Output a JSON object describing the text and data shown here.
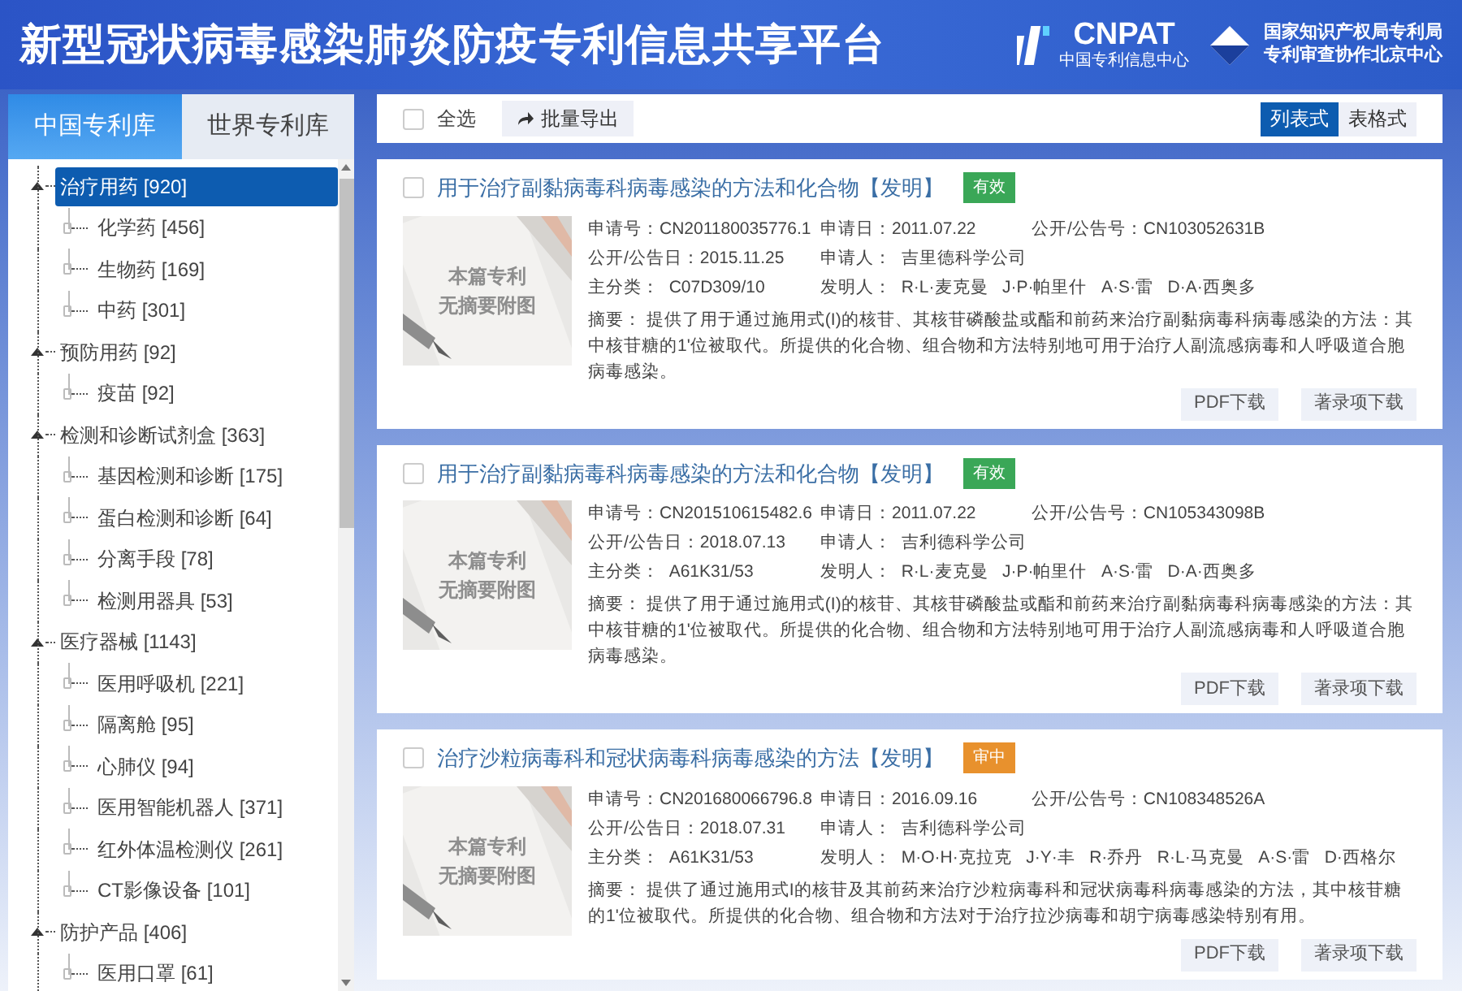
{
  "header": {
    "title": "新型冠状病毒感染肺炎防疫专利信息共享平台",
    "logo_1": {
      "name": "CNPAT",
      "subtitle": "中国专利信息中心"
    },
    "logo_2": {
      "line_1": "国家知识产权局专利局",
      "line_2": "专利审查协作北京中心"
    }
  },
  "sidebar": {
    "tabs": [
      {
        "label": "中国专利库",
        "selected": true
      },
      {
        "label": "世界专利库",
        "selected": false
      }
    ],
    "tree": [
      {
        "label": "治疗用药 [920]",
        "selected": true,
        "expanded": true,
        "children": [
          {
            "label": "化学药 [456]",
            "selected": false
          },
          {
            "label": "生物药 [169]",
            "selected": false
          },
          {
            "label": "中药 [301]",
            "selected": false
          }
        ]
      },
      {
        "label": "预防用药 [92]",
        "selected": false,
        "expanded": true,
        "children": [
          {
            "label": "疫苗 [92]",
            "selected": false
          }
        ]
      },
      {
        "label": "检测和诊断试剂盒 [363]",
        "selected": false,
        "expanded": true,
        "children": [
          {
            "label": "基因检测和诊断 [175]",
            "selected": false
          },
          {
            "label": "蛋白检测和诊断 [64]",
            "selected": false
          },
          {
            "label": "分离手段 [78]",
            "selected": false
          },
          {
            "label": "检测用器具 [53]",
            "selected": false
          }
        ]
      },
      {
        "label": "医疗器械 [1143]",
        "selected": false,
        "expanded": true,
        "children": [
          {
            "label": "医用呼吸机 [221]",
            "selected": false
          },
          {
            "label": "隔离舱 [95]",
            "selected": false
          },
          {
            "label": "心肺仪 [94]",
            "selected": false
          },
          {
            "label": "医用智能机器人 [371]",
            "selected": false
          },
          {
            "label": "红外体温检测仪 [261]",
            "selected": false
          },
          {
            "label": "CT影像设备 [101]",
            "selected": false
          }
        ]
      },
      {
        "label": "防护产品 [406]",
        "selected": false,
        "expanded": true,
        "children": [
          {
            "label": "医用口罩 [61]",
            "selected": false
          }
        ]
      }
    ]
  },
  "toolbar": {
    "select_all": {
      "label": "全选",
      "checked": false
    },
    "export_button": "批量导出",
    "views": [
      {
        "label": "列表式",
        "selected": true
      },
      {
        "label": "表格式",
        "selected": false
      }
    ]
  },
  "results": [
    {
      "checked": false,
      "title": "用于治疗副黏病毒科病毒感染的方法和化合物【发明】",
      "status": {
        "text": "有效",
        "color": "#3aa757"
      },
      "thumbnail": {
        "kind": "picture",
        "text_1": "本篇专利",
        "text_2": "无摘要附图"
      },
      "rows": [
        [
          "申请号：CN201180035776.1",
          "申请日：2011.07.22",
          "公开/公告号：CN103052631B"
        ],
        [
          "公开/公告日：2015.11.25",
          "申请人：  吉里德科学公司"
        ],
        [
          "主分类：  C07D309/10",
          "发明人：  R·L·麦克曼   J·P·帕里什   A·S·雷   D·A·西奥多"
        ]
      ],
      "abstract": "摘要：  提供了用于通过施用式(I)的核苷、其核苷磷酸盐或酯和前药来治疗副黏病毒科病毒感染的方法：其中核苷糖的1'位被取代。所提供的化合物、组合物和方法特别地可用于治疗人副流感病毒和人呼吸道合胞病毒感染。",
      "buttons": [
        "PDF下载",
        "著录项下载"
      ]
    },
    {
      "checked": false,
      "title": "用于治疗副黏病毒科病毒感染的方法和化合物【发明】",
      "status": {
        "text": "有效",
        "color": "#3aa757"
      },
      "thumbnail": {
        "kind": "picture",
        "text_1": "本篇专利",
        "text_2": "无摘要附图"
      },
      "rows": [
        [
          "申请号：CN201510615482.6",
          "申请日：2011.07.22",
          "公开/公告号：CN105343098B"
        ],
        [
          "公开/公告日：2018.07.13",
          "申请人：  吉利德科学公司"
        ],
        [
          "主分类：  A61K31/53",
          "发明人：  R·L·麦克曼   J·P·帕里什   A·S·雷   D·A·西奥多"
        ]
      ],
      "abstract": "摘要：  提供了用于通过施用式(I)的核苷、其核苷磷酸盐或酯和前药来治疗副黏病毒科病毒感染的方法：其中核苷糖的1'位被取代。所提供的化合物、组合物和方法特别地可用于治疗人副流感病毒和人呼吸道合胞病毒感染。",
      "buttons": [
        "PDF下载",
        "著录项下载"
      ]
    },
    {
      "checked": false,
      "title": "治疗沙粒病毒科和冠状病毒科病毒感染的方法【发明】",
      "status": {
        "text": "审中",
        "color": "#e8912d"
      },
      "thumbnail": {
        "kind": "picture",
        "text_1": "本篇专利",
        "text_2": "无摘要附图"
      },
      "rows": [
        [
          "申请号：CN201680066796.8",
          "申请日：2016.09.16",
          "公开/公告号：CN108348526A"
        ],
        [
          "公开/公告日：2018.07.31",
          "申请人：  吉利德科学公司"
        ],
        [
          "主分类：  A61K31/53",
          "发明人：  M·O·H·克拉克   J·Y·丰   R·乔丹   R·L·马克曼   A·S·雷   D·西格尔"
        ]
      ],
      "abstract": "摘要：  提供了通过施用式I的核苷及其前药来治疗沙粒病毒科和冠状病毒科病毒感染的方法，其中核苷糖的1'位被取代。所提供的化合物、组合物和方法对于治疗拉沙病毒和胡宁病毒感染特别有用。",
      "buttons": [
        "PDF下载",
        "著录项下载"
      ]
    }
  ]
}
